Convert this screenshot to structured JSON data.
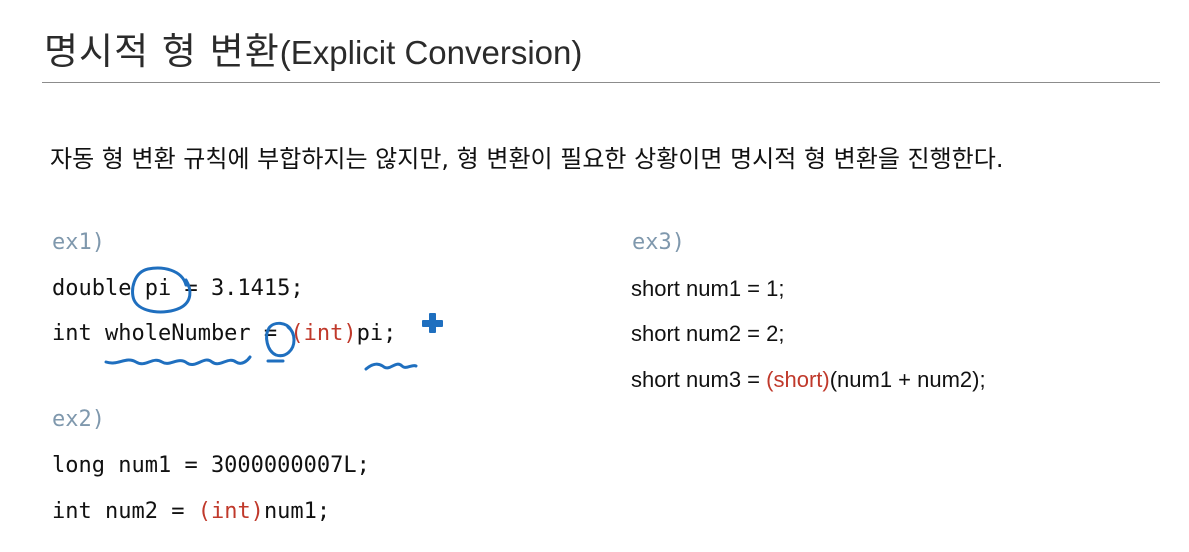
{
  "title": {
    "korean": "명시적 형 변환",
    "english": "(Explicit Conversion)"
  },
  "description": "자동 형 변환 규칙에 부합하지는 않지만, 형 변환이 필요한 상황이면 명시적 형 변환을 진행한다.",
  "ex1": {
    "label": "ex1)",
    "line1": "double pi = 3.1415;",
    "line2_pre": "int wholeNumber = ",
    "line2_cast": "(int)",
    "line2_post": "pi;"
  },
  "ex2": {
    "label": "ex2)",
    "line1": "long num1 = 3000000007L;",
    "line2_pre": "int num2 = ",
    "line2_cast": "(int)",
    "line2_post": "num1;"
  },
  "ex3": {
    "label": "ex3)",
    "line1": "short num1 = 1;",
    "line2": "short num2 = 2;",
    "line3_pre": "short num3 = ",
    "line3_cast": "(short)",
    "line3_post": "(num1 + num2);"
  },
  "colors": {
    "cast": "#c0392b",
    "label": "#7f98ad",
    "ink": "#1f6fbf"
  }
}
